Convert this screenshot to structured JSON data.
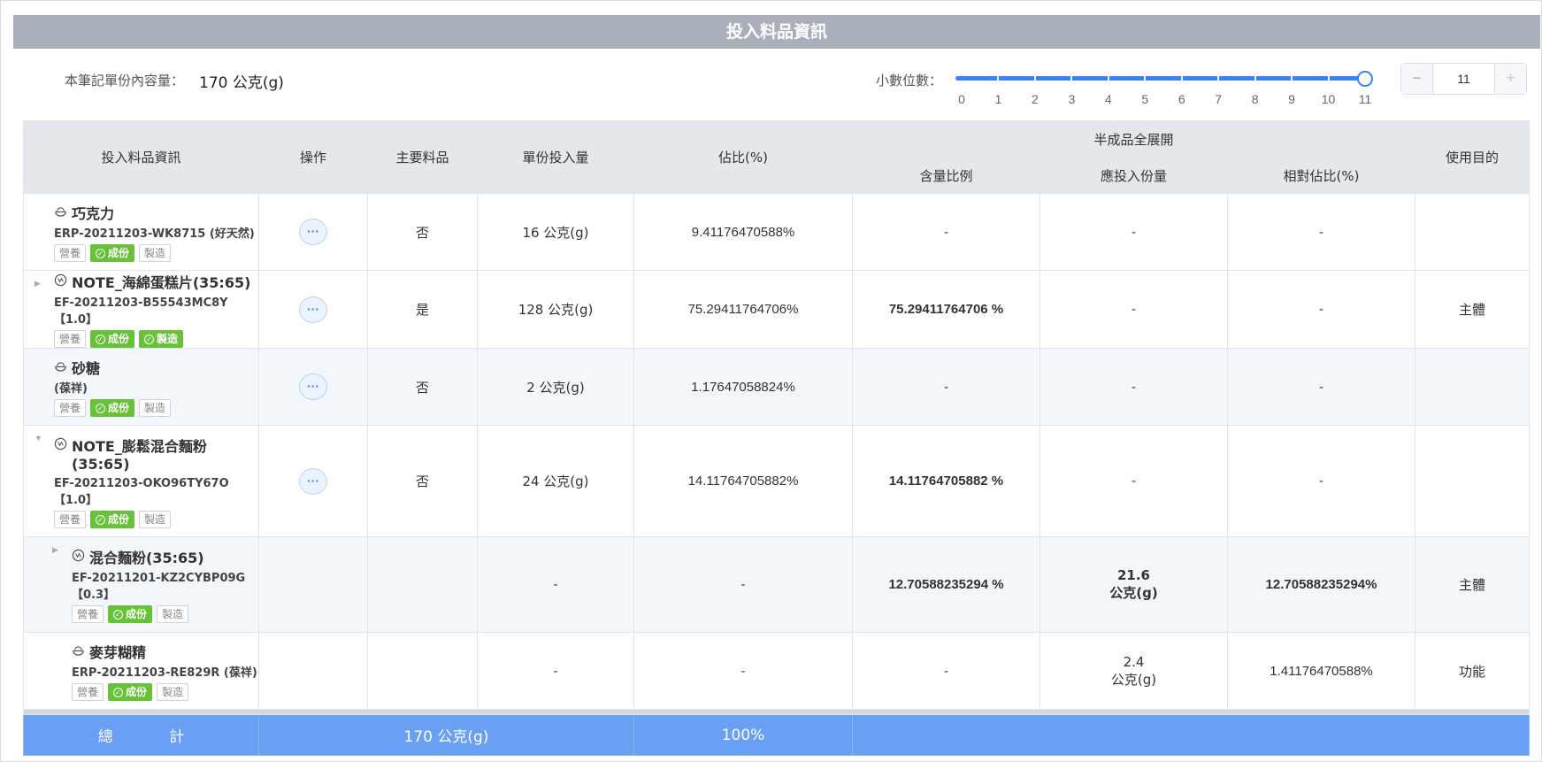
{
  "title": "投入料品資訊",
  "capacity": {
    "label": "本筆記單份內容量：",
    "value": "170 公克(g)"
  },
  "decimals": {
    "label": "小數位數：",
    "ticks": [
      "0",
      "1",
      "2",
      "3",
      "4",
      "5",
      "6",
      "7",
      "8",
      "9",
      "10",
      "11"
    ],
    "value": 11,
    "max": 11,
    "stepper_value": "11",
    "minus": "−",
    "plus": "+"
  },
  "columns": {
    "info": "投入料品資訊",
    "op": "操作",
    "main": "主要料品",
    "unit": "單份投入量",
    "ratio": "佔比(%)",
    "semi": "半成品全展開",
    "content": "含量比例",
    "should": "應投入份量",
    "relative": "相對佔比(%)",
    "purpose": "使用目的"
  },
  "tag_labels": {
    "nutrition": "營養",
    "ingredient": "成份",
    "manufacture": "製造"
  },
  "op_label": "···",
  "rows": [
    {
      "name": "巧克力",
      "code": "ERP-20211203-WK8715 (好天然)",
      "main": "否",
      "unit": "16 公克(g)",
      "ratio": "9.41176470588%",
      "content": "-",
      "should": "-",
      "relative": "-",
      "purpose": ""
    },
    {
      "name": "NOTE_海綿蛋糕片(35:65)",
      "code": "EF-20211203-B55543MC8Y【1.0】",
      "main": "是",
      "unit": "128 公克(g)",
      "ratio": "75.29411764706%",
      "content": "75.29411764706 %",
      "should": "-",
      "relative": "-",
      "purpose": "主體"
    },
    {
      "name": "砂糖",
      "code": "(葆祥)",
      "main": "否",
      "unit": "2 公克(g)",
      "ratio": "1.17647058824%",
      "content": "-",
      "should": "-",
      "relative": "-",
      "purpose": ""
    },
    {
      "name_1": "NOTE_膨鬆混合麵粉",
      "name_2": "(35:65)",
      "code_1": "EF-20211203-OKO96TY67O",
      "code_2": "【1.0】",
      "main": "否",
      "unit": "24 公克(g)",
      "ratio": "14.11764705882%",
      "content": "14.11764705882 %",
      "should": "-",
      "relative": "-",
      "purpose": ""
    },
    {
      "name": "混合麵粉(35:65)",
      "code_1": "EF-20211201-KZ2CYBP09G",
      "code_2": "【0.3】",
      "unit": "-",
      "ratio": "-",
      "content": "12.70588235294 %",
      "should_1": "21.6",
      "should_2": "公克(g)",
      "relative": "12.70588235294%",
      "purpose": "主體"
    },
    {
      "name": "麥芽糊精",
      "code": "ERP-20211203-RE829R (葆祥)",
      "unit": "-",
      "ratio": "-",
      "content": "-",
      "should_1": "2.4",
      "should_2": "公克(g)",
      "relative": "1.41176470588%",
      "purpose": "功能"
    }
  ],
  "total": {
    "label": "總 計",
    "unit": "170 公克(g)",
    "ratio": "100%"
  }
}
